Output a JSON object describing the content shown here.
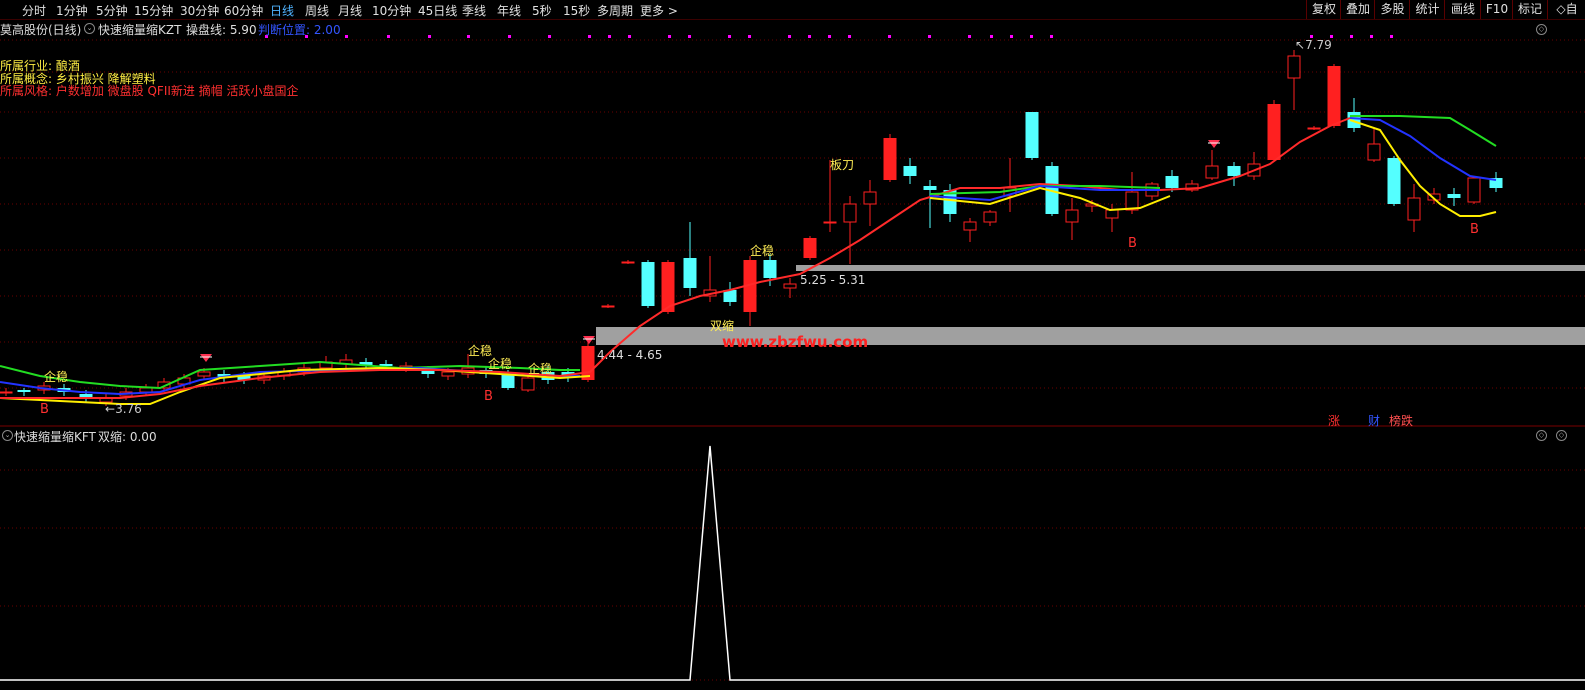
{
  "toolbar": {
    "timeframes": [
      "分时",
      "1分钟",
      "5分钟",
      "15分钟",
      "30分钟",
      "60分钟",
      "日线",
      "周线",
      "月线",
      "10分钟",
      "45日线",
      "季线",
      "年线",
      "5秒",
      "15秒",
      "多周期",
      "更多 >"
    ],
    "active_timeframe": "日线",
    "right_buttons": [
      "复权",
      "叠加",
      "多股",
      "统计",
      "画线",
      "F10",
      "标记"
    ],
    "auto_label": "◇自"
  },
  "main_pane": {
    "stock_name": "莫高股份(日线)",
    "indicator_name": "快速缩量缩KZT",
    "operating_line": "操盘线: 5.90",
    "judge_position": "判断位置: 2.00",
    "industry": "所属行业: 酿酒",
    "concept": "所属概念: 乡村振兴 降解塑料",
    "style": "所属风格: 户数增加 微盘股 QFII新进 摘帽 活跃小盘国企",
    "watermark": "www.zbzfwu.com",
    "zone_upper_label": "5.25 - 5.31",
    "zone_lower_label": "4.44 - 4.65",
    "low_price_label": "3.76",
    "high_price_label": "7.79",
    "signals": {
      "qiwen": "企稳",
      "b": "B",
      "shuangsuo": "双缩",
      "bandao": "板刀"
    },
    "corner_tags": [
      "涨",
      "财",
      "榜跌"
    ]
  },
  "sub_pane": {
    "indicator_name": "快速缩量缩KFT",
    "value_label": "双缩: 0.00"
  },
  "colors": {
    "up": "#ff2020",
    "down": "#54ffff",
    "ma_red": "#ff2a2a",
    "ma_green": "#22dd22",
    "ma_blue": "#2233ff",
    "ma_yellow": "#ffee00",
    "zone": "#a0a0a0",
    "grid": "#6a0000",
    "signal_text": "#ffee55",
    "b_text": "#ff3030",
    "magenta": "#ff00ff"
  }
}
